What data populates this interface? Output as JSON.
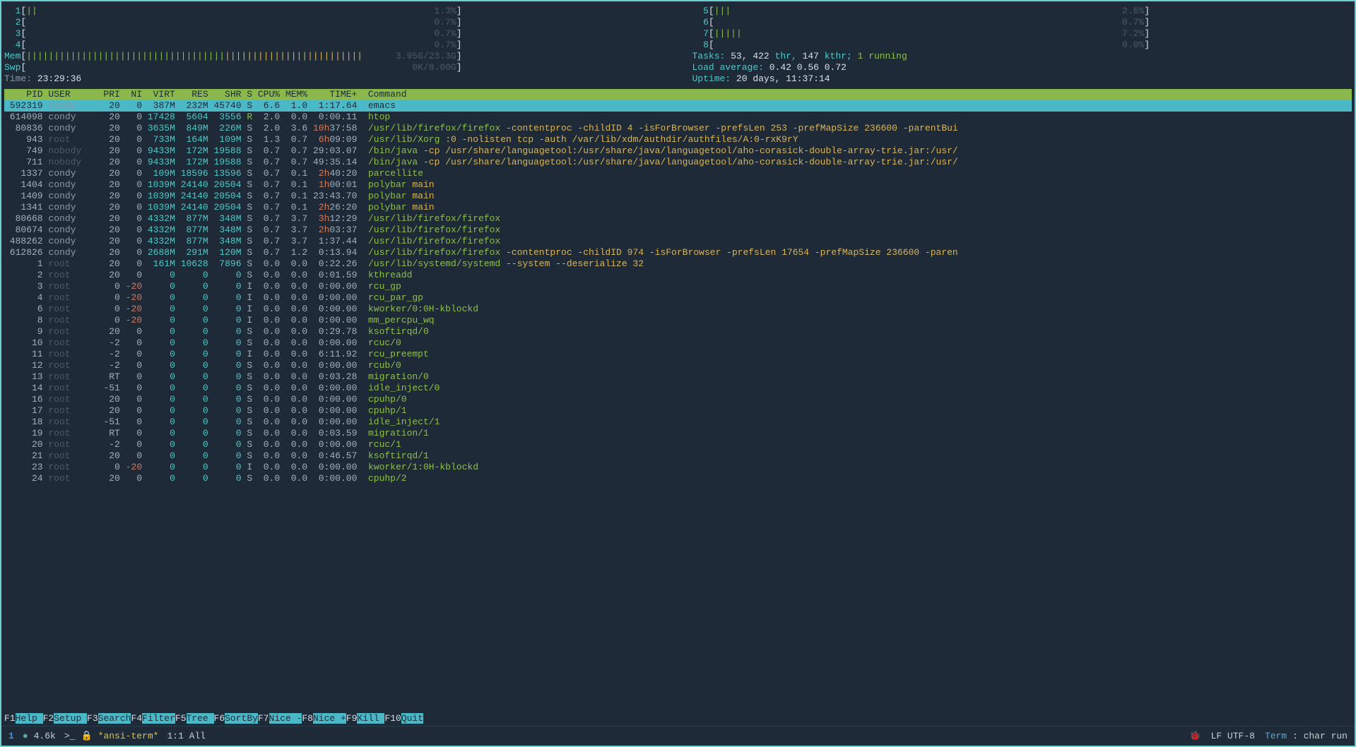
{
  "cpu_meters_left": [
    {
      "idx": "1",
      "bars": "||",
      "pct": "1.3%"
    },
    {
      "idx": "2",
      "bars": "",
      "pct": "0.7%"
    },
    {
      "idx": "3",
      "bars": "",
      "pct": "0.7%"
    },
    {
      "idx": "4",
      "bars": "",
      "pct": "0.7%"
    }
  ],
  "cpu_meters_right": [
    {
      "idx": "5",
      "bars": "|||",
      "pct": "2.6%"
    },
    {
      "idx": "6",
      "bars": "",
      "pct": "0.7%"
    },
    {
      "idx": "7",
      "bars": "|||||",
      "pct": "7.2%"
    },
    {
      "idx": "8",
      "bars": "",
      "pct": "0.0%"
    }
  ],
  "mem": {
    "label": "Mem",
    "bars": "|||||||||||||||||||||||||||||||||||||||||||||||||||||||||||||",
    "pct": "3.95G/23.3G"
  },
  "swp": {
    "label": "Swp",
    "bars": "",
    "pct": "0K/8.00G"
  },
  "time": {
    "label": "Time:",
    "value": "23:29:36"
  },
  "tasks": {
    "prefix": "Tasks:",
    "counts": "53, 422",
    "thr_label": "thr,",
    "kthr": "147",
    "kthr_label": "kthr;",
    "running": "1 running"
  },
  "loadavg": {
    "prefix": "Load average:",
    "v1": "0.42",
    "v2": "0.56",
    "v3": "0.72"
  },
  "uptime": {
    "prefix": "Uptime:",
    "value": "20 days, 11:37:14"
  },
  "columns": [
    "PID",
    "USER",
    "PRI",
    "NI",
    "VIRT",
    "RES",
    "SHR",
    "S",
    "CPU%",
    "MEM%",
    "TIME+",
    "Command"
  ],
  "processes": [
    {
      "pid": "592319",
      "user": "condy",
      "pri": "20",
      "ni": "0",
      "virt": "387M",
      "res": "232M",
      "shr": "45740",
      "s": "S",
      "cpu": "6.6",
      "mem": "1.0",
      "time": "1:17.64",
      "cmd": "emacs",
      "selected": true,
      "time_accent": ""
    },
    {
      "pid": "614098",
      "user": "condy",
      "pri": "20",
      "ni": "0",
      "virt": "17428",
      "res": "5604",
      "shr": "3556",
      "s": "R",
      "cpu": "2.0",
      "mem": "0.0",
      "time": "0:00.11",
      "cmd": "htop"
    },
    {
      "pid": "80836",
      "user": "condy",
      "pri": "20",
      "ni": "0",
      "virt": "3635M",
      "res": "849M",
      "shr": "226M",
      "s": "S",
      "cpu": "2.0",
      "mem": "3.6",
      "time": "37:58",
      "time_accent": "10h",
      "cmd": "/usr/lib/firefox/firefox -contentproc -childID 4 -isForBrowser -prefsLen 253 -prefMapSize 236600 -parentBui"
    },
    {
      "pid": "943",
      "user": "root",
      "pri": "20",
      "ni": "0",
      "virt": "733M",
      "res": "164M",
      "shr": "109M",
      "s": "S",
      "cpu": "1.3",
      "mem": "0.7",
      "time": "09:09",
      "time_accent": "6h",
      "cmd": "/usr/lib/Xorg :0 -nolisten tcp -auth /var/lib/xdm/authdir/authfiles/A:0-rxK9rY",
      "dim_user": true
    },
    {
      "pid": "749",
      "user": "nobody",
      "pri": "20",
      "ni": "0",
      "virt": "9433M",
      "res": "172M",
      "shr": "19588",
      "s": "S",
      "cpu": "0.7",
      "mem": "0.7",
      "time": "29:03.07",
      "cmd": "/bin/java -cp /usr/share/languagetool:/usr/share/java/languagetool/aho-corasick-double-array-trie.jar:/usr/",
      "dim_user": true
    },
    {
      "pid": "711",
      "user": "nobody",
      "pri": "20",
      "ni": "0",
      "virt": "9433M",
      "res": "172M",
      "shr": "19588",
      "s": "S",
      "cpu": "0.7",
      "mem": "0.7",
      "time": "49:35.14",
      "cmd": "/bin/java -cp /usr/share/languagetool:/usr/share/java/languagetool/aho-corasick-double-array-trie.jar:/usr/",
      "dim_user": true
    },
    {
      "pid": "1337",
      "user": "condy",
      "pri": "20",
      "ni": "0",
      "virt": "109M",
      "res": "18596",
      "shr": "13596",
      "s": "S",
      "cpu": "0.7",
      "mem": "0.1",
      "time": "40:20",
      "time_accent": "2h",
      "cmd": "parcellite"
    },
    {
      "pid": "1404",
      "user": "condy",
      "pri": "20",
      "ni": "0",
      "virt": "1039M",
      "res": "24140",
      "shr": "20504",
      "s": "S",
      "cpu": "0.7",
      "mem": "0.1",
      "time": "00:01",
      "time_accent": "1h",
      "cmd": "polybar main"
    },
    {
      "pid": "1409",
      "user": "condy",
      "pri": "20",
      "ni": "0",
      "virt": "1039M",
      "res": "24140",
      "shr": "20504",
      "s": "S",
      "cpu": "0.7",
      "mem": "0.1",
      "time": "23:43.70",
      "cmd": "polybar main"
    },
    {
      "pid": "1341",
      "user": "condy",
      "pri": "20",
      "ni": "0",
      "virt": "1039M",
      "res": "24140",
      "shr": "20504",
      "s": "S",
      "cpu": "0.7",
      "mem": "0.1",
      "time": "26:20",
      "time_accent": "2h",
      "cmd": "polybar main"
    },
    {
      "pid": "80668",
      "user": "condy",
      "pri": "20",
      "ni": "0",
      "virt": "4332M",
      "res": "877M",
      "shr": "348M",
      "s": "S",
      "cpu": "0.7",
      "mem": "3.7",
      "time": "12:29",
      "time_accent": "3h",
      "cmd": "/usr/lib/firefox/firefox"
    },
    {
      "pid": "80674",
      "user": "condy",
      "pri": "20",
      "ni": "0",
      "virt": "4332M",
      "res": "877M",
      "shr": "348M",
      "s": "S",
      "cpu": "0.7",
      "mem": "3.7",
      "time": "03:37",
      "time_accent": "2h",
      "cmd": "/usr/lib/firefox/firefox"
    },
    {
      "pid": "488262",
      "user": "condy",
      "pri": "20",
      "ni": "0",
      "virt": "4332M",
      "res": "877M",
      "shr": "348M",
      "s": "S",
      "cpu": "0.7",
      "mem": "3.7",
      "time": "1:37.44",
      "cmd": "/usr/lib/firefox/firefox"
    },
    {
      "pid": "612826",
      "user": "condy",
      "pri": "20",
      "ni": "0",
      "virt": "2688M",
      "res": "291M",
      "shr": "120M",
      "s": "S",
      "cpu": "0.7",
      "mem": "1.2",
      "time": "0:13.94",
      "cmd": "/usr/lib/firefox/firefox -contentproc -childID 974 -isForBrowser -prefsLen 17654 -prefMapSize 236600 -paren"
    },
    {
      "pid": "1",
      "user": "root",
      "pri": "20",
      "ni": "0",
      "virt": "161M",
      "res": "10628",
      "shr": "7896",
      "s": "S",
      "cpu": "0.0",
      "mem": "0.0",
      "time": "0:22.26",
      "cmd": "/usr/lib/systemd/systemd --system --deserialize 32",
      "dim_user": true
    },
    {
      "pid": "2",
      "user": "root",
      "pri": "20",
      "ni": "0",
      "virt": "0",
      "res": "0",
      "shr": "0",
      "s": "S",
      "cpu": "0.0",
      "mem": "0.0",
      "time": "0:01.59",
      "cmd": "kthreadd",
      "dim_user": true
    },
    {
      "pid": "3",
      "user": "root",
      "pri": "0",
      "ni": "-20",
      "virt": "0",
      "res": "0",
      "shr": "0",
      "s": "I",
      "cpu": "0.0",
      "mem": "0.0",
      "time": "0:00.00",
      "cmd": "rcu_gp",
      "dim_user": true,
      "ni_red": true
    },
    {
      "pid": "4",
      "user": "root",
      "pri": "0",
      "ni": "-20",
      "virt": "0",
      "res": "0",
      "shr": "0",
      "s": "I",
      "cpu": "0.0",
      "mem": "0.0",
      "time": "0:00.00",
      "cmd": "rcu_par_gp",
      "dim_user": true,
      "ni_red": true
    },
    {
      "pid": "6",
      "user": "root",
      "pri": "0",
      "ni": "-20",
      "virt": "0",
      "res": "0",
      "shr": "0",
      "s": "I",
      "cpu": "0.0",
      "mem": "0.0",
      "time": "0:00.00",
      "cmd": "kworker/0:0H-kblockd",
      "dim_user": true,
      "ni_red": true
    },
    {
      "pid": "8",
      "user": "root",
      "pri": "0",
      "ni": "-20",
      "virt": "0",
      "res": "0",
      "shr": "0",
      "s": "I",
      "cpu": "0.0",
      "mem": "0.0",
      "time": "0:00.00",
      "cmd": "mm_percpu_wq",
      "dim_user": true,
      "ni_red": true
    },
    {
      "pid": "9",
      "user": "root",
      "pri": "20",
      "ni": "0",
      "virt": "0",
      "res": "0",
      "shr": "0",
      "s": "S",
      "cpu": "0.0",
      "mem": "0.0",
      "time": "0:29.78",
      "cmd": "ksoftirqd/0",
      "dim_user": true
    },
    {
      "pid": "10",
      "user": "root",
      "pri": "-2",
      "ni": "0",
      "virt": "0",
      "res": "0",
      "shr": "0",
      "s": "S",
      "cpu": "0.0",
      "mem": "0.0",
      "time": "0:00.00",
      "cmd": "rcuc/0",
      "dim_user": true
    },
    {
      "pid": "11",
      "user": "root",
      "pri": "-2",
      "ni": "0",
      "virt": "0",
      "res": "0",
      "shr": "0",
      "s": "I",
      "cpu": "0.0",
      "mem": "0.0",
      "time": "6:11.92",
      "cmd": "rcu_preempt",
      "dim_user": true
    },
    {
      "pid": "12",
      "user": "root",
      "pri": "-2",
      "ni": "0",
      "virt": "0",
      "res": "0",
      "shr": "0",
      "s": "S",
      "cpu": "0.0",
      "mem": "0.0",
      "time": "0:00.00",
      "cmd": "rcub/0",
      "dim_user": true
    },
    {
      "pid": "13",
      "user": "root",
      "pri": "RT",
      "ni": "0",
      "virt": "0",
      "res": "0",
      "shr": "0",
      "s": "S",
      "cpu": "0.0",
      "mem": "0.0",
      "time": "0:03.28",
      "cmd": "migration/0",
      "dim_user": true
    },
    {
      "pid": "14",
      "user": "root",
      "pri": "-51",
      "ni": "0",
      "virt": "0",
      "res": "0",
      "shr": "0",
      "s": "S",
      "cpu": "0.0",
      "mem": "0.0",
      "time": "0:00.00",
      "cmd": "idle_inject/0",
      "dim_user": true
    },
    {
      "pid": "16",
      "user": "root",
      "pri": "20",
      "ni": "0",
      "virt": "0",
      "res": "0",
      "shr": "0",
      "s": "S",
      "cpu": "0.0",
      "mem": "0.0",
      "time": "0:00.00",
      "cmd": "cpuhp/0",
      "dim_user": true
    },
    {
      "pid": "17",
      "user": "root",
      "pri": "20",
      "ni": "0",
      "virt": "0",
      "res": "0",
      "shr": "0",
      "s": "S",
      "cpu": "0.0",
      "mem": "0.0",
      "time": "0:00.00",
      "cmd": "cpuhp/1",
      "dim_user": true
    },
    {
      "pid": "18",
      "user": "root",
      "pri": "-51",
      "ni": "0",
      "virt": "0",
      "res": "0",
      "shr": "0",
      "s": "S",
      "cpu": "0.0",
      "mem": "0.0",
      "time": "0:00.00",
      "cmd": "idle_inject/1",
      "dim_user": true
    },
    {
      "pid": "19",
      "user": "root",
      "pri": "RT",
      "ni": "0",
      "virt": "0",
      "res": "0",
      "shr": "0",
      "s": "S",
      "cpu": "0.0",
      "mem": "0.0",
      "time": "0:03.59",
      "cmd": "migration/1",
      "dim_user": true
    },
    {
      "pid": "20",
      "user": "root",
      "pri": "-2",
      "ni": "0",
      "virt": "0",
      "res": "0",
      "shr": "0",
      "s": "S",
      "cpu": "0.0",
      "mem": "0.0",
      "time": "0:00.00",
      "cmd": "rcuc/1",
      "dim_user": true
    },
    {
      "pid": "21",
      "user": "root",
      "pri": "20",
      "ni": "0",
      "virt": "0",
      "res": "0",
      "shr": "0",
      "s": "S",
      "cpu": "0.0",
      "mem": "0.0",
      "time": "0:46.57",
      "cmd": "ksoftirqd/1",
      "dim_user": true
    },
    {
      "pid": "23",
      "user": "root",
      "pri": "0",
      "ni": "-20",
      "virt": "0",
      "res": "0",
      "shr": "0",
      "s": "I",
      "cpu": "0.0",
      "mem": "0.0",
      "time": "0:00.00",
      "cmd": "kworker/1:0H-kblockd",
      "dim_user": true,
      "ni_red": true
    },
    {
      "pid": "24",
      "user": "root",
      "pri": "20",
      "ni": "0",
      "virt": "0",
      "res": "0",
      "shr": "0",
      "s": "S",
      "cpu": "0.0",
      "mem": "0.0",
      "time": "0:00.00",
      "cmd": "cpuhp/2",
      "dim_user": true
    }
  ],
  "fkeys": [
    {
      "k": "F1",
      "a": "Help  "
    },
    {
      "k": "F2",
      "a": "Setup "
    },
    {
      "k": "F3",
      "a": "Search"
    },
    {
      "k": "F4",
      "a": "Filter"
    },
    {
      "k": "F5",
      "a": "Tree  "
    },
    {
      "k": "F6",
      "a": "SortBy"
    },
    {
      "k": "F7",
      "a": "Nice -"
    },
    {
      "k": "F8",
      "a": "Nice +"
    },
    {
      "k": "F9",
      "a": "Kill  "
    },
    {
      "k": "F10",
      "a": "Quit  "
    }
  ],
  "status": {
    "evil": "1",
    "size": "4.6k",
    "buffer": "*ansi-term*",
    "pos": "1:1 All",
    "encoding": "LF UTF-8",
    "mode_key": "Term",
    "mode_rest": " : char run"
  }
}
